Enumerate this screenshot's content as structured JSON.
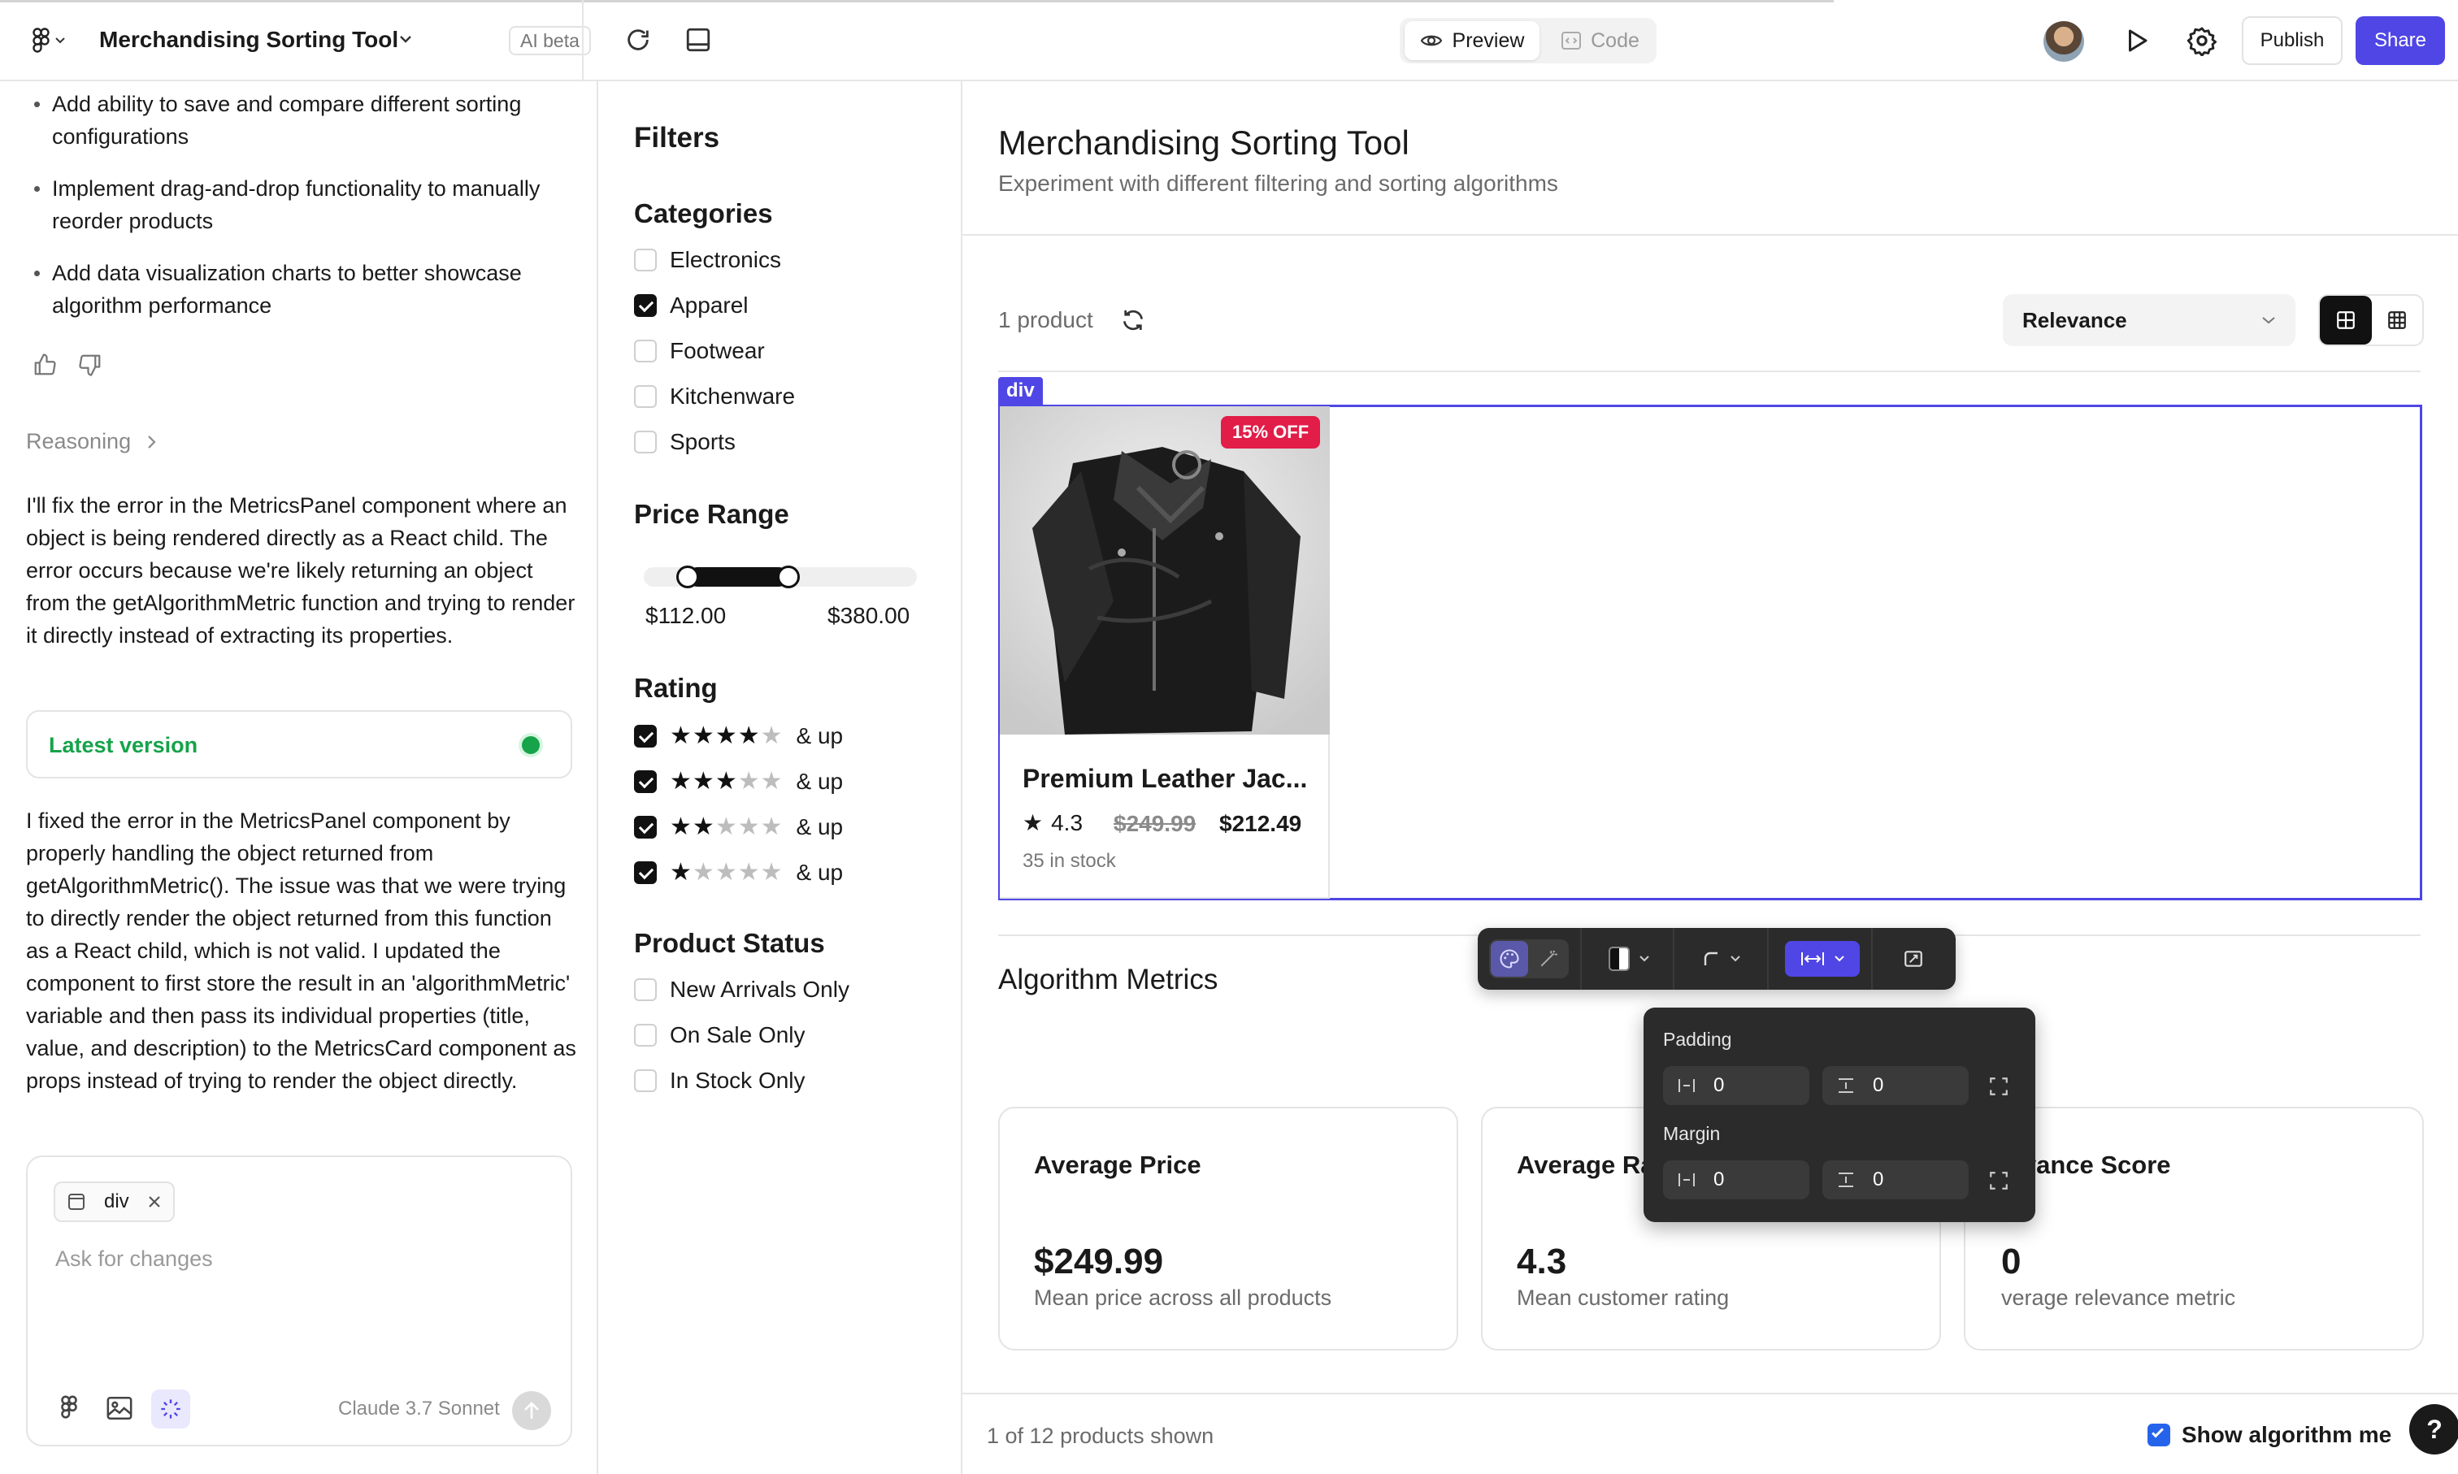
{
  "topbar": {
    "project_title": "Merchandising Sorting Tool",
    "ai_badge": "AI beta",
    "preview_label": "Preview",
    "code_label": "Code",
    "publish_label": "Publish",
    "share_label": "Share"
  },
  "chat": {
    "bullets": [
      "Add ability to save and compare different sorting configurations",
      "Implement drag-and-drop functionality to manually reorder products",
      "Add data visualization charts to better showcase algorithm performance"
    ],
    "reasoning_label": "Reasoning",
    "message1": "I'll fix the error in the MetricsPanel component where an object is being rendered directly as a React child. The error occurs because we're likely returning an object from the getAlgorithmMetric function and trying to render it directly instead of extracting its properties.",
    "version_label": "Latest version",
    "message2": "I fixed the error in the MetricsPanel component by properly handling the object returned from getAlgorithmMetric(). The issue was that we were trying to directly render the object returned from this function as a React child, which is not valid. I updated the component to first store the result in an 'algorithmMetric' variable and then pass its individual properties (title, value, and description) to the MetricsCard component as props instead of trying to render the object directly.",
    "chip_label": "div",
    "input_placeholder": "Ask for changes",
    "model_label": "Claude 3.7 Sonnet"
  },
  "filters": {
    "title": "Filters",
    "categories_title": "Categories",
    "categories": [
      {
        "label": "Electronics",
        "checked": false
      },
      {
        "label": "Apparel",
        "checked": true
      },
      {
        "label": "Footwear",
        "checked": false
      },
      {
        "label": "Kitchenware",
        "checked": false
      },
      {
        "label": "Sports",
        "checked": false
      }
    ],
    "price_title": "Price Range",
    "price_min": "$112.00",
    "price_max": "$380.00",
    "price_range_fraction": [
      0.16,
      0.53
    ],
    "rating_title": "Rating",
    "ratings": [
      {
        "stars": 4,
        "label": "& up",
        "checked": true
      },
      {
        "stars": 3,
        "label": "& up",
        "checked": true
      },
      {
        "stars": 2,
        "label": "& up",
        "checked": true
      },
      {
        "stars": 1,
        "label": "& up",
        "checked": true
      }
    ],
    "status_title": "Product Status",
    "statuses": [
      {
        "label": "New Arrivals Only",
        "checked": false
      },
      {
        "label": "On Sale Only",
        "checked": false
      },
      {
        "label": "In Stock Only",
        "checked": false
      }
    ]
  },
  "main": {
    "title": "Merchandising Sorting Tool",
    "subtitle": "Experiment with different filtering and sorting algorithms",
    "product_count": "1 product",
    "sort_value": "Relevance",
    "selected_tag": "div",
    "product": {
      "badge": "15% OFF",
      "name": "Premium Leather Jac...",
      "rating": "4.3",
      "old_price": "$249.99",
      "price": "$212.49",
      "stock": "35 in stock"
    },
    "metrics_title": "Algorithm Metrics",
    "metrics": [
      {
        "title": "Average Price",
        "value": "$249.99",
        "desc": "Mean price across all products"
      },
      {
        "title": "Average Ra",
        "value": "4.3",
        "desc": "Mean customer rating"
      },
      {
        "title": "levance Score",
        "value": "0",
        "desc": "verage relevance metric"
      }
    ],
    "footer_count": "1 of 12 products shown",
    "footer_toggle": "Show algorithm me"
  },
  "inspector": {
    "padding_label": "Padding",
    "margin_label": "Margin",
    "padding_h": "0",
    "padding_v": "0",
    "margin_h": "0",
    "margin_v": "0"
  },
  "colors": {
    "accent": "#4f46e5",
    "sale": "#e11d48",
    "version_green": "#16a34a"
  }
}
